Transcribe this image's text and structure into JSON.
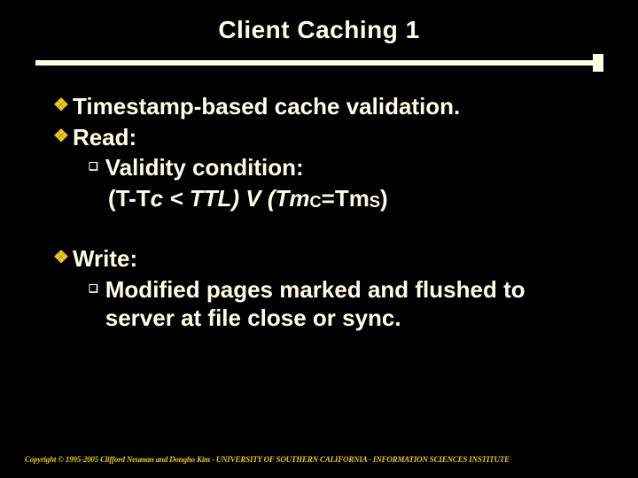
{
  "slide": {
    "title": "Client Caching 1",
    "items": {
      "p1": "Timestamp-based cache validation.",
      "p2": "Read:",
      "p2a": "Validity condition:",
      "p2b_pre": "(T-T",
      "p2b_c": "c",
      "p2b_mid": " < TTL) V (Tm",
      "p2b_c2": "C",
      "p2b_eq": "=Tm",
      "p2b_s": "S",
      "p2b_end": ")",
      "p3": "Write:",
      "p3a": "Modified pages marked and flushed to server at file close or sync."
    },
    "footer": "Copyright © 1995-2005 Clifford Neuman and Dongho Kim - UNIVERSITY OF SOUTHERN CALIFORNIA - INFORMATION SCIENCES INSTITUTE"
  }
}
